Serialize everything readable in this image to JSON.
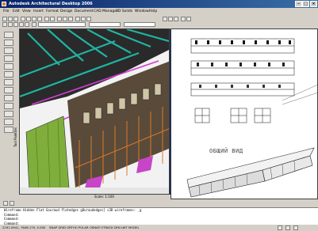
{
  "window": {
    "title": "Autodesk Architectural Desktop 2006"
  },
  "menu": [
    "File",
    "Edit",
    "View",
    "Insert",
    "Format",
    "Design",
    "Document",
    "CAD Manager",
    "3D Solids",
    "Window",
    "Help"
  ],
  "left_palette": {
    "label": "Tool Palettes"
  },
  "viewport_status": {
    "scale": "Scale: 1:100"
  },
  "layout": {
    "caption": "ОБЩИЙ ВИД"
  },
  "command": {
    "lines": [
      "Wireframe Hidden Flat Gouraud flatedges gOuraudedges] <3D wireframe>: _g",
      "Command:",
      "Command:",
      "Command:"
    ]
  },
  "status": {
    "coords": "2291.0941, 7648.179, 0.000",
    "modes": "SNAP  GRID  ORTHO  POLAR  OSNAP  OTRACK  DYN  LWT  MODEL"
  },
  "colors": {
    "title_bar": "#0a246a",
    "chrome": "#d4d0c8",
    "model_bg": "#f2f2f2"
  },
  "icons": [
    "app-icon",
    "minimize-icon",
    "maximize-icon",
    "close-icon"
  ]
}
